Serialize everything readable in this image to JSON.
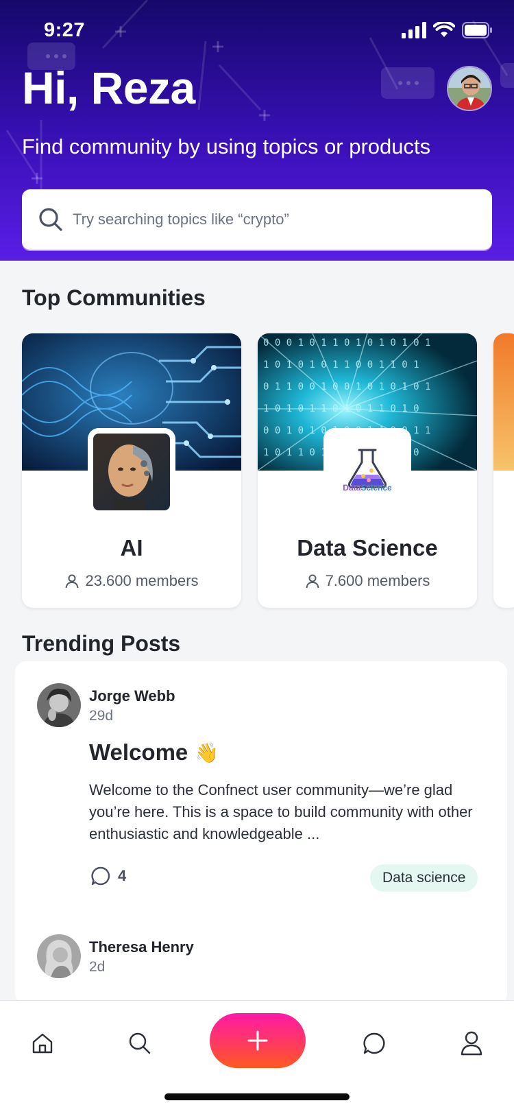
{
  "status_bar": {
    "time": "9:27"
  },
  "header": {
    "greeting": "Hi, Reza",
    "subtitle": "Find community by using topics or products"
  },
  "search": {
    "placeholder": "Try searching topics like “crypto”"
  },
  "top_communities": {
    "title": "Top Communities",
    "items": [
      {
        "name": "AI",
        "members": "23.600 members"
      },
      {
        "name": "Data Science",
        "members": "7.600 members",
        "logo_text_a": "Data",
        "logo_text_b": "Science"
      }
    ]
  },
  "trending_posts": {
    "title": "Trending Posts",
    "posts": [
      {
        "author": "Jorge Webb",
        "time": "29d",
        "title": "Welcome",
        "emoji": "👋",
        "body": "Welcome to the Confnect user community—we’re glad you’re here. This is a space to build community with other enthusiastic and knowledgeable ...",
        "comments": "4",
        "tag": "Data science"
      },
      {
        "author": "Theresa Henry",
        "time": "2d"
      }
    ]
  },
  "colors": {
    "header_gradient": [
      "#15086b",
      "#5a1ee6"
    ],
    "fab_gradient": [
      "#ff1aa6",
      "#ff5a1e"
    ],
    "tag_bg": "#e4f7f1"
  },
  "tab_bar": {
    "icons": [
      "home-icon",
      "search-icon",
      "plus-icon",
      "chat-icon",
      "profile-icon"
    ]
  }
}
